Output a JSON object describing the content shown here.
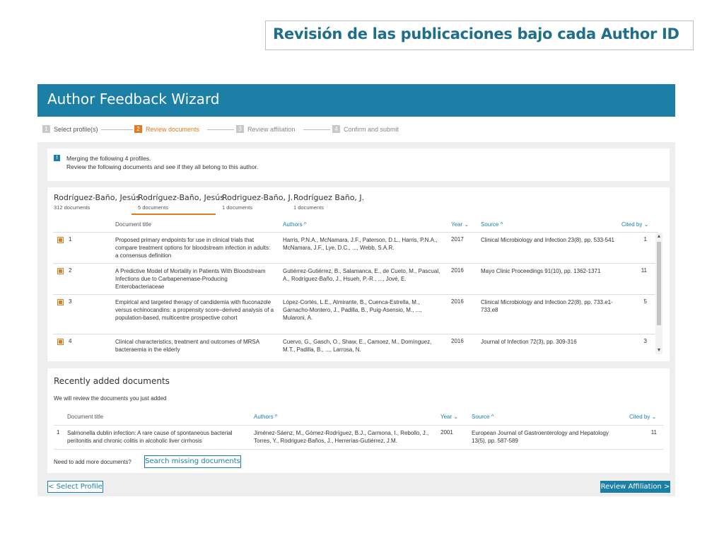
{
  "slide": {
    "title": "Revisión de las publicaciones bajo cada Author ID"
  },
  "wizard": {
    "title": "Author Feedback Wizard",
    "steps": [
      {
        "num": "1",
        "label": "Select profile(s)"
      },
      {
        "num": "2",
        "label": "Review documents"
      },
      {
        "num": "3",
        "label": "Review affiliation"
      },
      {
        "num": "4",
        "label": "Confirm and submit"
      }
    ]
  },
  "info": {
    "icon": "info-icon",
    "line1": "Merging the following 4 profiles.",
    "line2": "Review the following documents and see if they all belong to this author."
  },
  "profiles": [
    {
      "name": "Rodríguez-Baño, Jesús",
      "count": "312 documents"
    },
    {
      "name": "Rodríguez-Baño, Jesús",
      "count": "5 documents"
    },
    {
      "name": "Rodriguez-Baño, J.",
      "count": "1 documents"
    },
    {
      "name": "Rodríguez Baño, J.",
      "count": "1 documents"
    }
  ],
  "doc_table": {
    "headers": {
      "title": "Document title",
      "authors": "Authors ^",
      "year": "Year ⌄",
      "source": "Source ^",
      "cited": "Cited by ⌄"
    },
    "rows": [
      {
        "num": "1",
        "title": "Proposed primary endpoints for use in clinical trials that compare treatment options for bloodstream infection in adults: a consensus definition",
        "authors": "Harris, P.N.A., McNamara, J.F., Paterson, D.L., Harris, P.N.A., McNamara, J.F., Lye, D.C., ..., Webb, S.A.R.",
        "year": "2017",
        "source": "Clinical Microbiology and Infection 23(8), pp. 533-541",
        "cited": "1"
      },
      {
        "num": "2",
        "title": "A Predictive Model of Mortality in Patients With Bloodstream Infections due to Carbapenemase-Producing Enterobacteriaceae",
        "authors": "Gutiérrez-Gutiérrez, B., Salamanca, E., de Cueto, M., Pascual, A., Rodríguez-Baño, J., Hsueh, P.-R., ..., Jové, E.",
        "year": "2016",
        "source": "Mayo Clinic Proceedings 91(10), pp. 1362-1371",
        "cited": "11"
      },
      {
        "num": "3",
        "title": "Empirical and targeted therapy of candidemia with fluconazole versus echinocandins: a propensity score–derived analysis of a population-based, multicentre prospective cohort",
        "authors": "López-Cortés, L.E., Almirante, B., Cuenca-Estrella, M., Garnacho-Montero, J., Padilla, B., Puig-Asensio, M., ..., Mularoni, A.",
        "year": "2016",
        "source": "Clinical Microbiology and Infection 22(8), pp. 733.e1-733.e8",
        "cited": "5"
      },
      {
        "num": "4",
        "title": "Clinical characteristics, treatment and outcomes of MRSA bacteraemia in the elderly",
        "authors": "Cuervo, G., Gasch, O., Shaw, E., Camoez, M., Domínguez, M.T., Padilla, B., ..., Larrosa, N.",
        "year": "2016",
        "source": "Journal of Infection 72(3), pp. 309-316",
        "cited": "3"
      }
    ]
  },
  "recent": {
    "title": "Recently added documents",
    "subtitle": "We will review the documents you just added",
    "headers": {
      "title": "Document title",
      "authors": "Authors ^",
      "year": "Year ⌄",
      "source": "Source ^",
      "cited": "Cited by ⌄"
    },
    "rows": [
      {
        "num": "1",
        "title": "Salmonella dublin infection: A rare cause of spontaneous bacterial peritonitis and chronic colitis in alcoholic liver cirrhosis",
        "authors": "Jiménez-Sáenz, M., Gómez-Rodríguez, B.J., Carmona, I., Rebollo, J., Torres, Y., Rodriguez-Baños, J., Herrerías-Gutiérrez, J.M.",
        "year": "2001",
        "source": "European Journal of Gastroenterology and Hepatology 13(5), pp. 587-589",
        "cited": "11"
      }
    ],
    "need_more": "Need to add more documents?",
    "search_missing": "Search missing documents"
  },
  "nav": {
    "select_profile": "< Select Profile",
    "review_affiliation": "Review Affiliation >"
  },
  "colors": {
    "header": "#1b7fa6",
    "active_step": "#e07b22",
    "title_text": "#1f6e8c"
  }
}
